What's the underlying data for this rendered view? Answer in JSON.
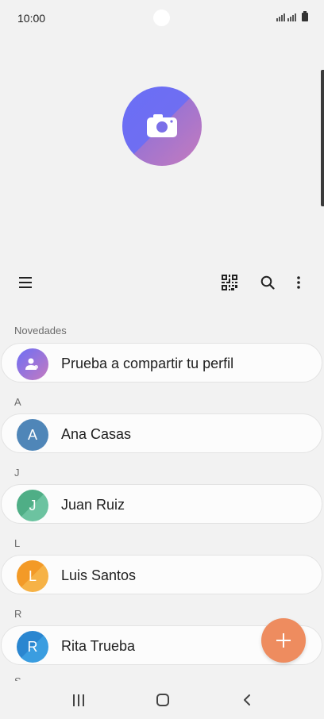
{
  "status_bar": {
    "time": "10:00"
  },
  "toolbar": {
    "menu_icon": "hamburger-menu-icon",
    "qr_icon": "qr-code-icon",
    "search_icon": "search-icon",
    "more_icon": "more-vertical-icon"
  },
  "sections": {
    "novedades": "Novedades",
    "a": "A",
    "j": "J",
    "l": "L",
    "r": "R",
    "s_partial": "S"
  },
  "contacts": [
    {
      "name": "Prueba a compartir tu perfil",
      "initial": "",
      "color": "#8a6fd8",
      "icon": "share-profile-icon"
    },
    {
      "name": "Ana Casas",
      "initial": "A",
      "color": "#4f86b8"
    },
    {
      "name": "Juan Ruiz",
      "initial": "J",
      "color": "#5bb38c"
    },
    {
      "name": "Luis Santos",
      "initial": "L",
      "color": "#f3a232"
    },
    {
      "name": "Rita Trueba",
      "initial": "R",
      "color": "#2c8fd6"
    }
  ],
  "fab": {
    "icon": "plus-icon",
    "color": "#ee8c5f"
  },
  "nav": {
    "recents_icon": "recents-icon",
    "home_icon": "home-icon",
    "back_icon": "back-icon"
  }
}
